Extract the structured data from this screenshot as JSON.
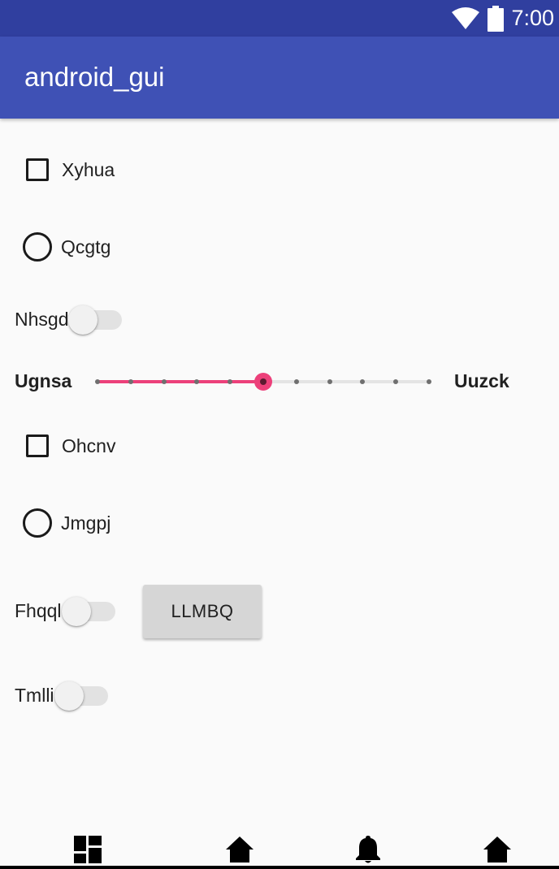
{
  "status_bar": {
    "time": "7:00",
    "icons": [
      "wifi-icon",
      "battery-icon"
    ]
  },
  "app_bar": {
    "title": "android_gui"
  },
  "controls": {
    "checkbox_1": {
      "label": "Xyhua",
      "checked": false
    },
    "radio_1": {
      "label": "Qcgtg",
      "selected": false
    },
    "switch_1": {
      "label": "Nhsgd",
      "on": false
    },
    "slider": {
      "min_label": "Ugnsa",
      "max_label": "Uuzck",
      "steps": 10,
      "value": 5
    },
    "checkbox_2": {
      "label": "Ohcnv",
      "checked": false
    },
    "radio_2": {
      "label": "Jmgpj",
      "selected": false
    },
    "switch_2": {
      "label": "Fhqql",
      "on": false
    },
    "button": {
      "label": "LLMBQ"
    },
    "switch_3": {
      "label": "Tmlli",
      "on": false
    }
  },
  "bottom_nav": {
    "items": [
      "dashboard-icon",
      "home-icon",
      "notifications-icon",
      "home-icon"
    ]
  },
  "colors": {
    "status_bar": "#303f9f",
    "app_bar": "#3f51b5",
    "accent": "#ec407a",
    "background": "#fafafa"
  }
}
